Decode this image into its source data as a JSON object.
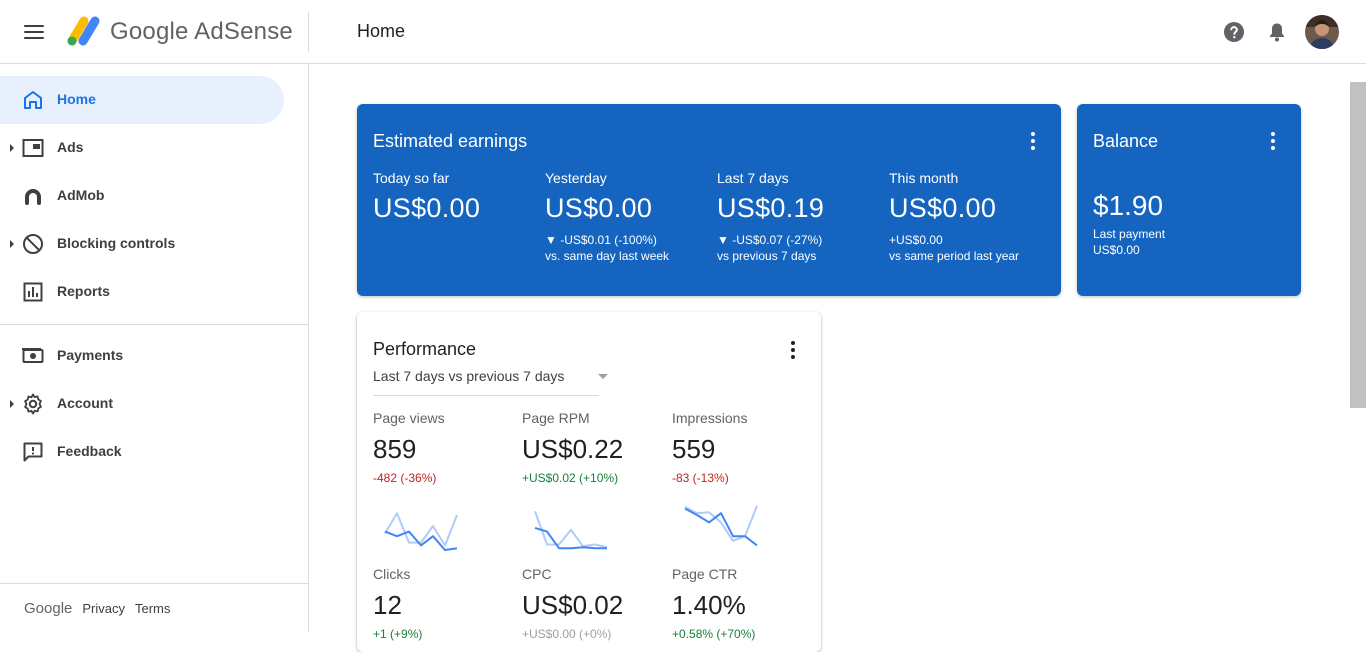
{
  "header": {
    "brand": "Google AdSense",
    "page_title": "Home"
  },
  "sidebar": {
    "items": [
      {
        "label": "Home",
        "icon": "home-icon",
        "active": true
      },
      {
        "label": "Ads",
        "icon": "ads-icon"
      },
      {
        "label": "AdMob",
        "icon": "admob-icon"
      },
      {
        "label": "Blocking controls",
        "icon": "block-icon"
      },
      {
        "label": "Reports",
        "icon": "reports-icon"
      },
      {
        "label": "Payments",
        "icon": "payments-icon"
      },
      {
        "label": "Account",
        "icon": "gear-icon"
      },
      {
        "label": "Feedback",
        "icon": "feedback-icon"
      }
    ],
    "footer": {
      "google": "Google",
      "privacy": "Privacy",
      "terms": "Terms"
    }
  },
  "earnings": {
    "title": "Estimated earnings",
    "metrics": [
      {
        "label": "Today so far",
        "value": "US$0.00",
        "change": "",
        "compare": ""
      },
      {
        "label": "Yesterday",
        "value": "US$0.00",
        "change": "▼ -US$0.01 (-100%)",
        "compare": "vs. same day last week"
      },
      {
        "label": "Last 7 days",
        "value": "US$0.19",
        "change": "▼ -US$0.07 (-27%)",
        "compare": "vs previous 7 days"
      },
      {
        "label": "This month",
        "value": "US$0.00",
        "change": "+US$0.00",
        "compare": "vs same period last year"
      }
    ]
  },
  "balance": {
    "title": "Balance",
    "value": "$1.90",
    "last_payment_label": "Last payment",
    "last_payment_value": "US$0.00"
  },
  "performance": {
    "title": "Performance",
    "period": "Last 7 days vs previous 7 days",
    "metrics": [
      {
        "label": "Page views",
        "value": "859",
        "change": "-482 (-36%)",
        "trend": "negative",
        "spark_current": [
          30,
          35,
          30,
          45,
          35,
          50,
          48
        ],
        "spark_previous": [
          32,
          10,
          42,
          42,
          24,
          45,
          12
        ]
      },
      {
        "label": "Page RPM",
        "value": "US$0.22",
        "change": "+US$0.02 (+10%)",
        "trend": "positive",
        "spark_current": [
          26,
          30,
          48,
          48,
          47,
          48,
          48
        ],
        "spark_previous": [
          8,
          44,
          44,
          28,
          46,
          44,
          47
        ]
      },
      {
        "label": "Impressions",
        "value": "559",
        "change": "-83 (-13%)",
        "trend": "negative",
        "spark_current": [
          5,
          12,
          20,
          10,
          35,
          35,
          45
        ],
        "spark_previous": [
          3,
          10,
          9,
          20,
          40,
          35,
          2
        ]
      },
      {
        "label": "Clicks",
        "value": "12",
        "change": "+1 (+9%)",
        "trend": "positive"
      },
      {
        "label": "CPC",
        "value": "US$0.02",
        "change": "+US$0.00 (+0%)",
        "trend": "positive"
      },
      {
        "label": "Page CTR",
        "value": "1.40%",
        "change": "+0.58% (+70%)",
        "trend": "positive"
      }
    ]
  },
  "colors": {
    "card_blue": "#1565c0",
    "accent": "#1a73e8",
    "negative": "#c5221f",
    "positive": "#188038",
    "spark_current": "#4285f4",
    "spark_previous": "#aecbfa"
  }
}
